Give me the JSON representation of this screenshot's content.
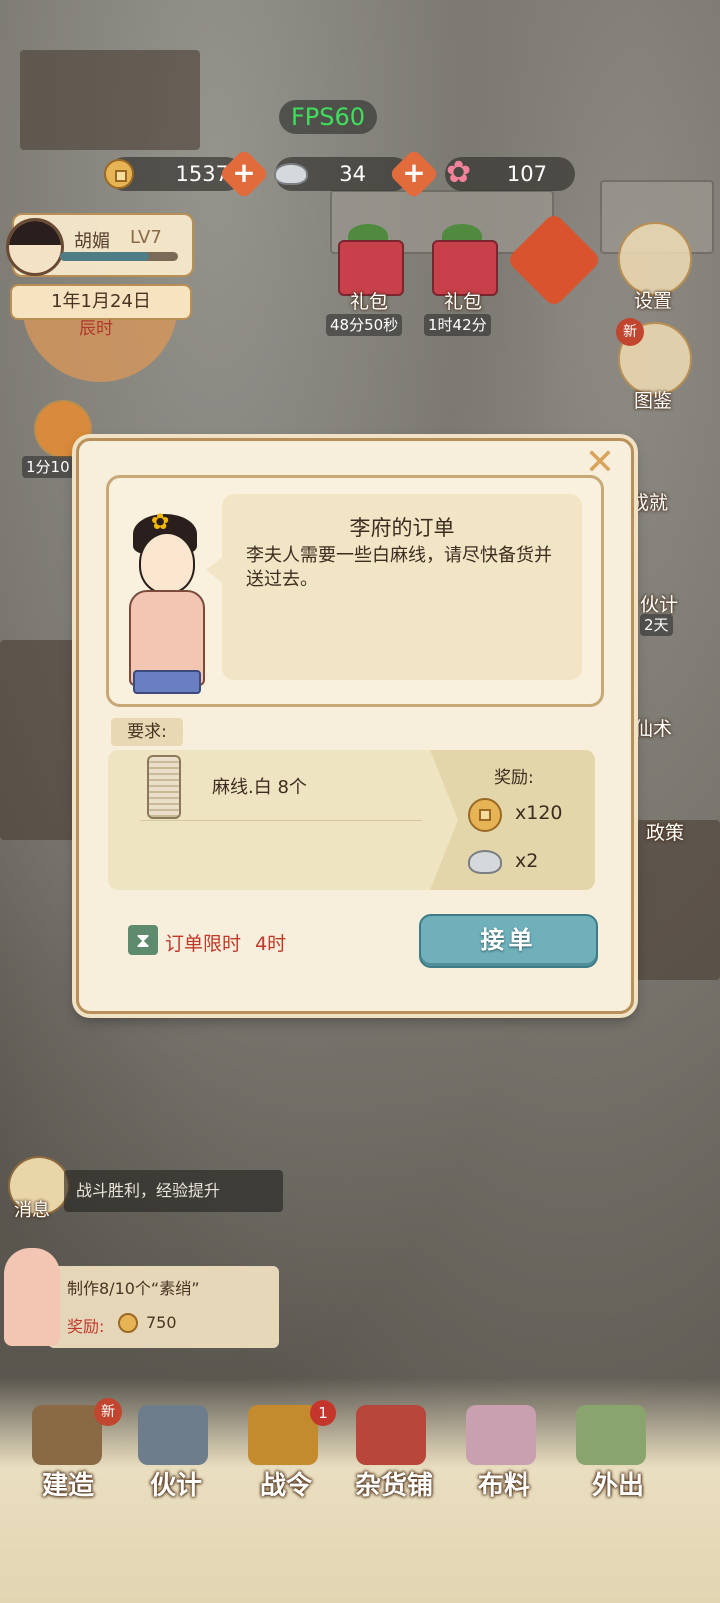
{
  "hud": {
    "fps": "FPS60",
    "copper": "1537",
    "silver": "34",
    "flower": "107"
  },
  "player": {
    "name": "胡媚",
    "level": "LV7",
    "xp_fraction": 0.75,
    "date": "1年1月24日",
    "time_of_day": "辰时"
  },
  "gifts": [
    {
      "label": "礼包",
      "timer": "48分50秒"
    },
    {
      "label": "礼包",
      "timer": "1时42分"
    }
  ],
  "side_menu": {
    "settings": "设置",
    "new_badge": "新",
    "catalog": "图鉴",
    "achievement": "成就",
    "staff": "伙计",
    "staff_timer": "2天",
    "magic": "仙术",
    "policy": "政策",
    "left_timer": "1分10"
  },
  "dialog": {
    "title": "李府的订单",
    "text": "李夫人需要一些白麻线，请尽快备货并送过去。",
    "requirement_label": "要求:",
    "item": "麻线.白 8个",
    "reward_label": "奖励:",
    "reward_copper": "x120",
    "reward_silver": "x2",
    "limit_label": "订单限时",
    "limit_value": "4时",
    "accept": "接单"
  },
  "message": {
    "text": "战斗胜利，经验提升",
    "label": "消息"
  },
  "task": {
    "progress": "制作8/10个“素绡”",
    "reward_label": "奖励:",
    "reward_value": "750"
  },
  "nav": {
    "build": "建造",
    "staff": "伙计",
    "battle": "战令",
    "battle_badge": "1",
    "store": "杂货铺",
    "cloth": "布料",
    "outing": "外出",
    "new_badge": "新"
  },
  "colors": {
    "accent_blue": "#6fb0bb",
    "limit_red": "#c0392b",
    "fps_green": "#3ee05b"
  }
}
